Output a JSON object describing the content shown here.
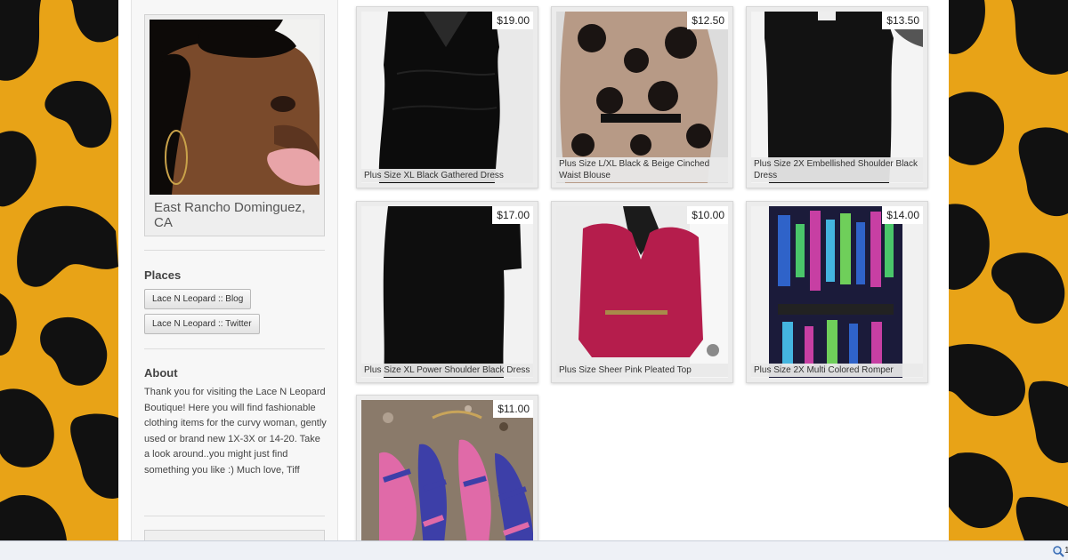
{
  "profile": {
    "location": "East Rancho Dominguez, CA"
  },
  "places": {
    "title": "Places",
    "links": [
      "Lace N Leopard :: Blog",
      "Lace N Leopard :: Twitter"
    ]
  },
  "about": {
    "title": "About",
    "text": "Thank you for visiting the Lace N Leopard Boutique! Here you will find fashionable clothing items for the curvy woman, gently used or brand new 1X-3X or 14-20. Take a look around..you might just find something you like :) Much love, Tiff"
  },
  "items": [
    {
      "price": "$19.00",
      "title": "Plus Size XL Black Gathered Dress"
    },
    {
      "price": "$12.50",
      "title": "Plus Size L/XL Black & Beige Cinched Waist Blouse"
    },
    {
      "price": "$13.50",
      "title": "Plus Size 2X Embellished Shoulder Black Dress"
    },
    {
      "price": "$17.00",
      "title": "Plus Size XL Power Shoulder Black Dress"
    },
    {
      "price": "$10.00",
      "title": "Plus Size Sheer Pink Pleated Top"
    },
    {
      "price": "$14.00",
      "title": "Plus Size 2X Multi Colored Romper"
    },
    {
      "price": "$11.00",
      "title": ""
    }
  ],
  "statusbar": {
    "zoom": "1"
  },
  "colors": {
    "leopard_gold": "#e8a317",
    "leopard_spot": "#111111",
    "page_bg": "#ffffff",
    "sidebar_bg": "#f7f7f7"
  }
}
